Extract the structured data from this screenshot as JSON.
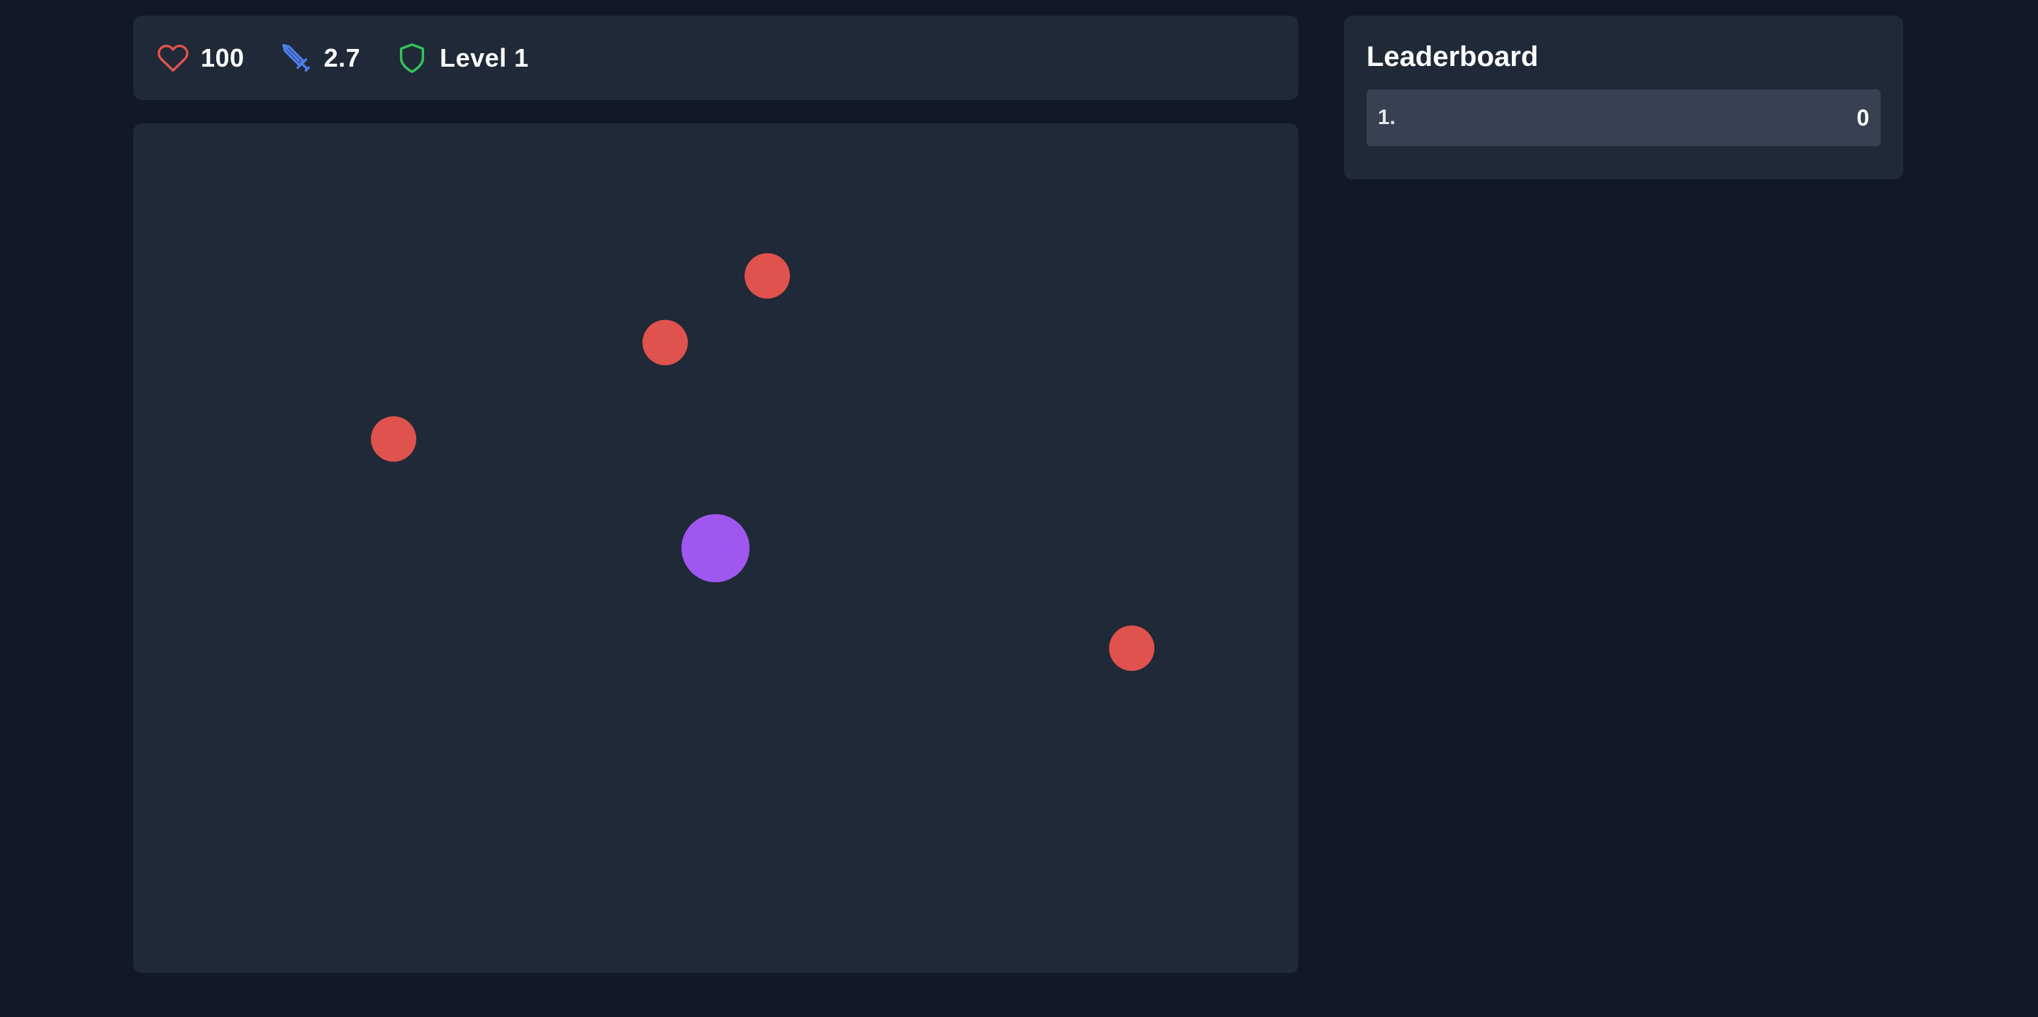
{
  "stats": {
    "health": "100",
    "attack": "2.7",
    "level": "Level 1"
  },
  "icons": {
    "health": "heart-icon",
    "attack": "sword-icon",
    "level": "shield-icon"
  },
  "colors": {
    "background": "#111827",
    "panel": "#1f2937",
    "row": "#374151",
    "heart": "#e0524d",
    "sword": "#4f7de8",
    "shield": "#34c35a",
    "player": "#a057f0",
    "enemy": "#e0524d"
  },
  "leaderboard": {
    "title": "Leaderboard",
    "entries": [
      {
        "rank": "1.",
        "name": "",
        "score": "0"
      }
    ]
  }
}
